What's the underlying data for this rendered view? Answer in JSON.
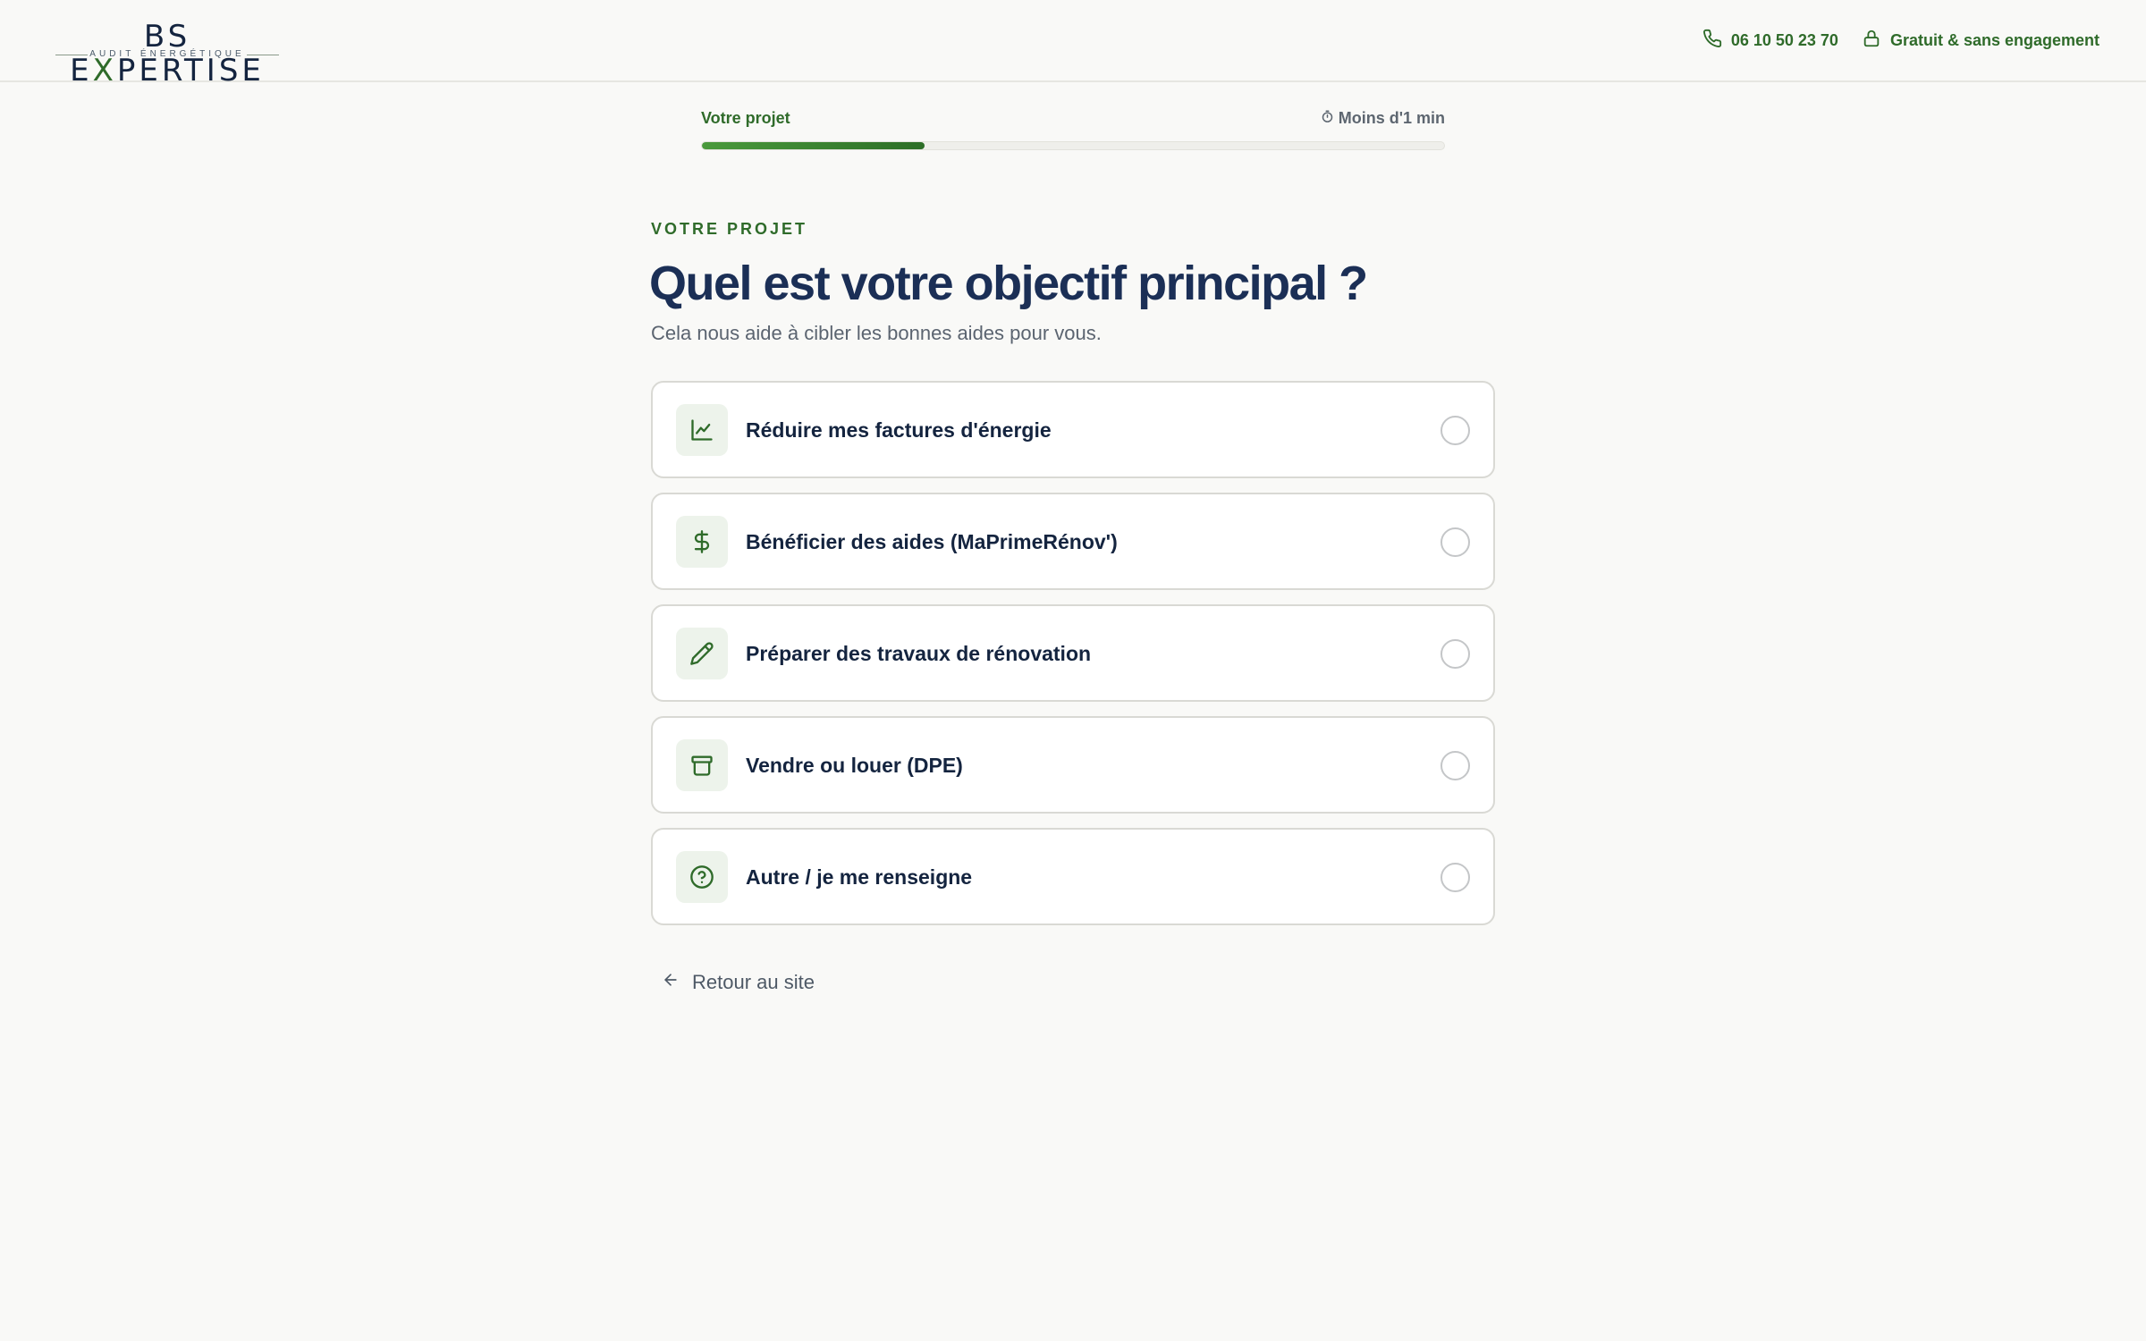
{
  "brand": {
    "name_left": "BS E",
    "name_x": "X",
    "name_right": "PERTISE",
    "tagline": "AUDIT ÉNERGÉTIQUE",
    "accent_color": "#2f6b2a",
    "navy_color": "#1b2f56"
  },
  "header": {
    "phone": "06 10 50 23 70",
    "badge": "Gratuit & sans engagement"
  },
  "progress": {
    "step_label": "Votre projet",
    "time_label": "Moins d'1 min",
    "fraction": 0.3
  },
  "main": {
    "eyebrow": "VOTRE PROJET",
    "title": "Quel est votre objectif principal ?",
    "subtitle": "Cela nous aide à cibler les bonnes aides pour vous."
  },
  "options": [
    {
      "label": "Réduire mes factures d'énergie",
      "icon": "chart-line-icon",
      "selected": false
    },
    {
      "label": "Bénéficier des aides (MaPrimeRénov')",
      "icon": "dollar-icon",
      "selected": false
    },
    {
      "label": "Préparer des travaux de rénovation",
      "icon": "pencil-icon",
      "selected": false
    },
    {
      "label": "Vendre ou louer (DPE)",
      "icon": "archive-box-icon",
      "selected": false
    },
    {
      "label": "Autre / je me renseigne",
      "icon": "help-circle-icon",
      "selected": false
    }
  ],
  "footer": {
    "back_label": "Retour au site"
  }
}
